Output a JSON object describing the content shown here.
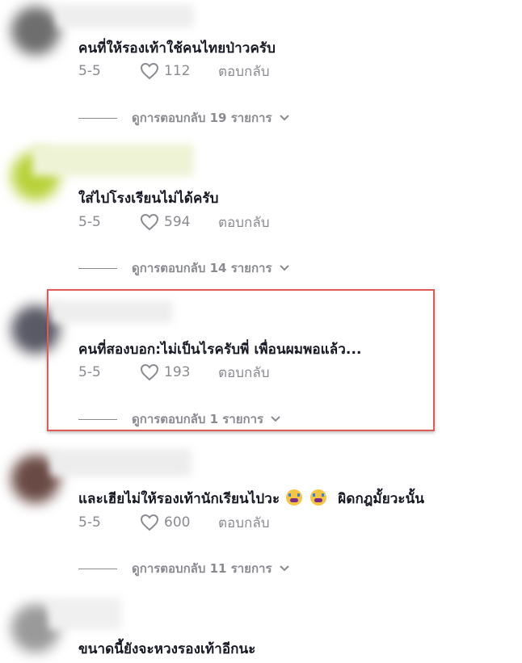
{
  "comments": [
    {
      "text": "คนที่ให้รองเท้าใช้คนไทยป่าวครับ",
      "date": "5-5",
      "likes": "112",
      "reply_label": "ตอบกลับ",
      "view_replies": "ดูการตอบกลับ 19 รายการ"
    },
    {
      "text": "ใส่ไปโรงเรียนไม่ได้ครับ",
      "date": "5-5",
      "likes": "594",
      "reply_label": "ตอบกลับ",
      "view_replies": "ดูการตอบกลับ 14 รายการ"
    },
    {
      "text": "คนที่สองบอก:ไม่เป็นไรครับพี่ เพื่อนผมพอแล้ว...",
      "date": "5-5",
      "likes": "193",
      "reply_label": "ตอบกลับ",
      "view_replies": "ดูการตอบกลับ 1 รายการ"
    },
    {
      "text_before": "และเฮียไม่ให้รองเท้านักเรียนไปวะ",
      "text_after": "ผิดกฎมั้ยวะนั้น",
      "date": "5-5",
      "likes": "600",
      "reply_label": "ตอบกลับ",
      "view_replies": "ดูการตอบกลับ 11 รายการ"
    },
    {
      "text": "ขนาดนี้ยังจะหวงรองเท้าอีกนะ"
    }
  ],
  "colors": {
    "text": "#161823",
    "secondary": "#8a8b91",
    "highlight_border": "#e05a5a"
  },
  "icons": {
    "like": "heart-outline-icon",
    "expand": "chevron-down-icon",
    "emoji": "crying-face-emoji"
  }
}
